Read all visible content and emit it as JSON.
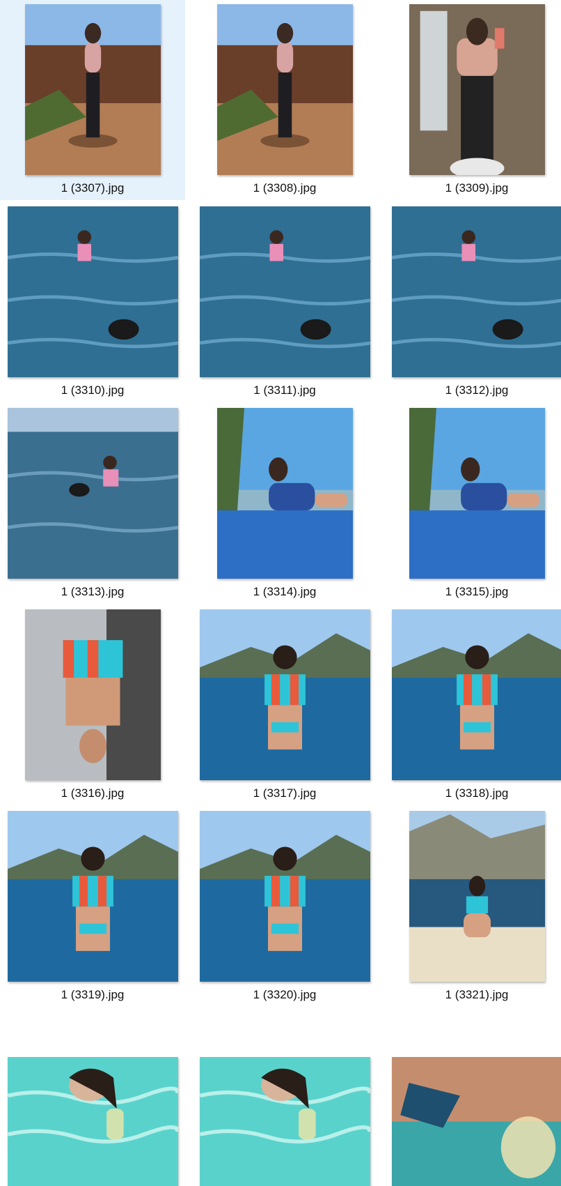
{
  "files": [
    {
      "name": "1 (3307).jpg",
      "selected": true,
      "scene": "garden"
    },
    {
      "name": "1 (3308).jpg",
      "selected": false,
      "scene": "garden"
    },
    {
      "name": "1 (3309).jpg",
      "selected": false,
      "scene": "mirror"
    },
    {
      "name": "1 (3310).jpg",
      "selected": false,
      "scene": "sea"
    },
    {
      "name": "1 (3311).jpg",
      "selected": false,
      "scene": "sea"
    },
    {
      "name": "1 (3312).jpg",
      "selected": false,
      "scene": "sea"
    },
    {
      "name": "1 (3313).jpg",
      "selected": false,
      "scene": "sea-sky"
    },
    {
      "name": "1 (3314).jpg",
      "selected": false,
      "scene": "beach"
    },
    {
      "name": "1 (3315).jpg",
      "selected": false,
      "scene": "beach"
    },
    {
      "name": "1 (3316).jpg",
      "selected": false,
      "scene": "deck"
    },
    {
      "name": "1 (3317).jpg",
      "selected": false,
      "scene": "coast"
    },
    {
      "name": "1 (3318).jpg",
      "selected": false,
      "scene": "coast"
    },
    {
      "name": "1 (3319).jpg",
      "selected": false,
      "scene": "coast"
    },
    {
      "name": "1 (3320).jpg",
      "selected": false,
      "scene": "coast"
    },
    {
      "name": "1 (3321).jpg",
      "selected": false,
      "scene": "boat"
    },
    {
      "name": "",
      "selected": false,
      "scene": "pool"
    },
    {
      "name": "",
      "selected": false,
      "scene": "pool"
    },
    {
      "name": "",
      "selected": false,
      "scene": "pool-close"
    }
  ],
  "colors": {
    "selection": "#e5f1fb",
    "label_text": "#111111"
  }
}
